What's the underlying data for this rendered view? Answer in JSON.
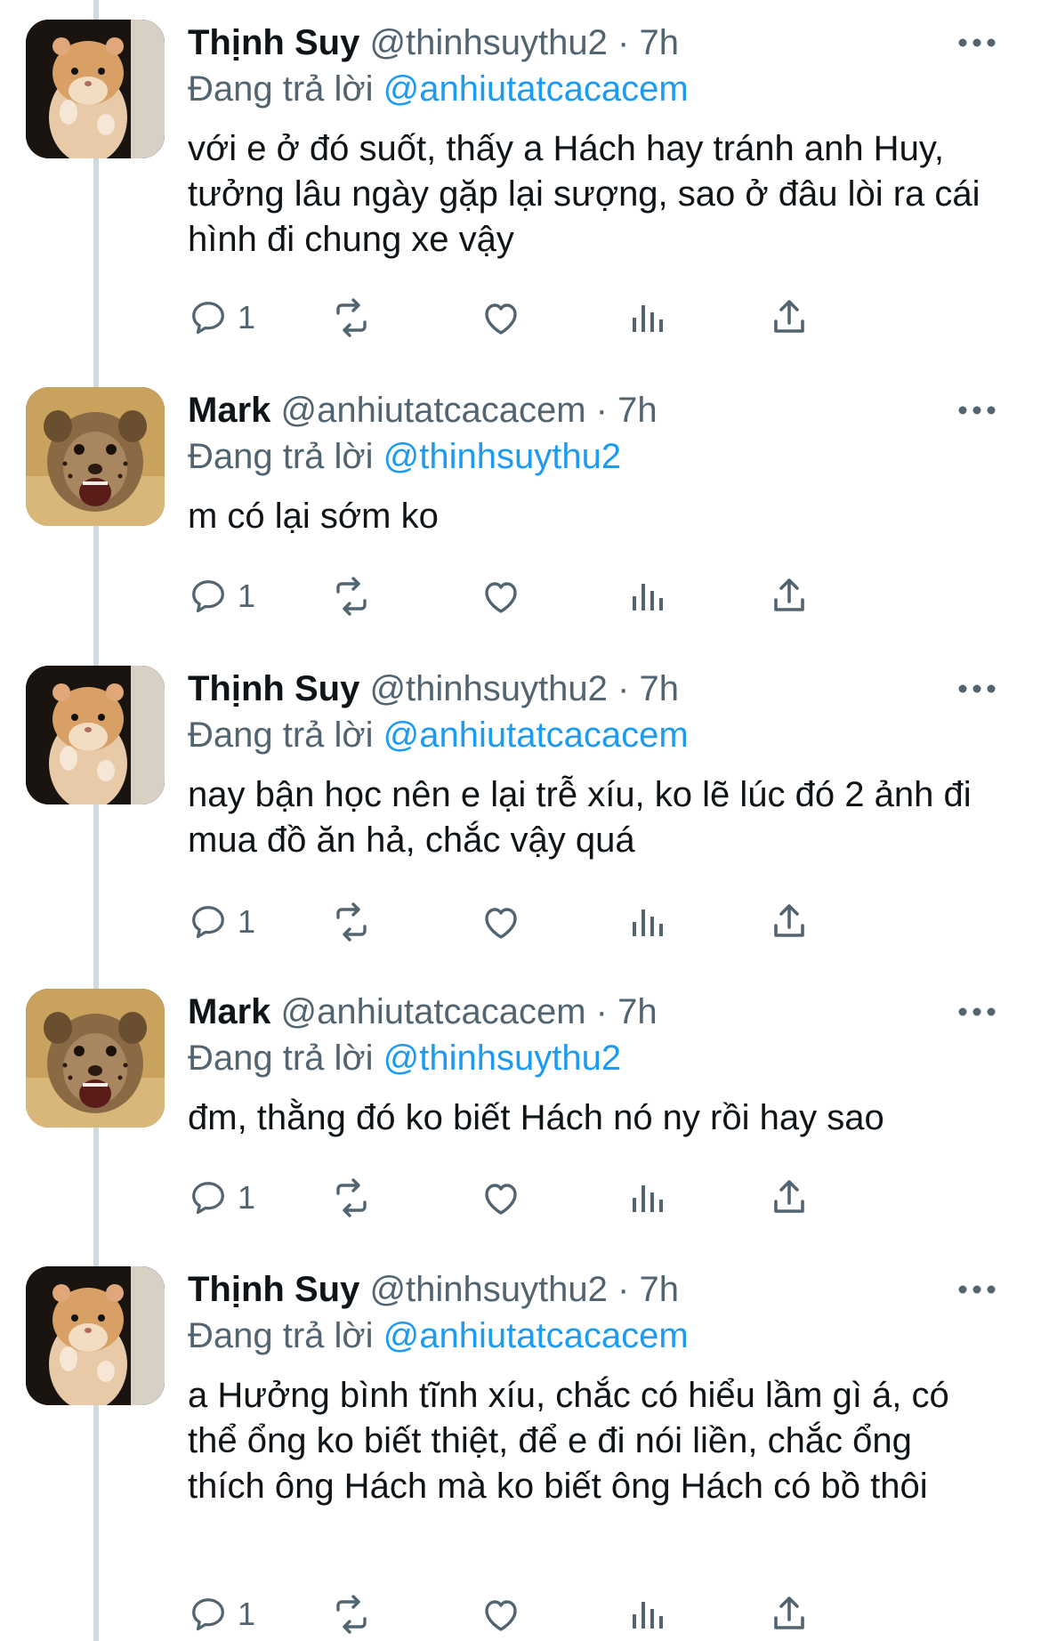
{
  "tweets": [
    {
      "name": "Thịnh Suy",
      "handle": "@thinhsuythu2",
      "time": "7h",
      "replying_prefix": "Đang trả lời",
      "replying_to": "@anhiutatcacacem",
      "text": "với e ở đó suốt, thấy a Hách hay tránh anh Huy, tưởng lâu ngày gặp lại sượng, sao ở đâu lòi ra cái hình đi chung xe vậy",
      "reply_count": "1",
      "avatar": "hamster-avatar"
    },
    {
      "name": "Mark",
      "handle": "@anhiutatcacacem",
      "time": "7h",
      "replying_prefix": "Đang trả lời",
      "replying_to": "@thinhsuythu2",
      "text": "m có lại sớm ko",
      "reply_count": "1",
      "avatar": "cheetah-cub-avatar"
    },
    {
      "name": "Thịnh Suy",
      "handle": "@thinhsuythu2",
      "time": "7h",
      "replying_prefix": "Đang trả lời",
      "replying_to": "@anhiutatcacacem",
      "text": "nay bận học nên e lại trễ xíu, ko lẽ lúc đó 2 ảnh đi mua đồ ăn hả, chắc vậy quá",
      "reply_count": "1",
      "avatar": "hamster-avatar"
    },
    {
      "name": "Mark",
      "handle": "@anhiutatcacacem",
      "time": "7h",
      "replying_prefix": "Đang trả lời",
      "replying_to": "@thinhsuythu2",
      "text": "đm, thằng đó ko biết Hách nó ny rồi hay sao",
      "reply_count": "1",
      "avatar": "cheetah-cub-avatar"
    },
    {
      "name": "Thịnh Suy",
      "handle": "@thinhsuythu2",
      "time": "7h",
      "replying_prefix": "Đang trả lời",
      "replying_to": "@anhiutatcacacem",
      "text": "a Hưởng bình tĩnh xíu, chắc có hiểu lầm gì á, có thể ổng ko biết thiệt, để e đi nói liền, chắc ổng thích ông Hách mà ko biết ông Hách có bồ thôi",
      "reply_count": "1",
      "avatar": "hamster-avatar"
    }
  ],
  "separator": "·",
  "colors": {
    "text": "#0f1419",
    "secondary": "#536471",
    "link": "#1d9bf0",
    "thread_line": "#cfd9de"
  },
  "icons": [
    "reply-icon",
    "retweet-icon",
    "like-icon",
    "analytics-icon",
    "share-icon",
    "more-icon"
  ]
}
